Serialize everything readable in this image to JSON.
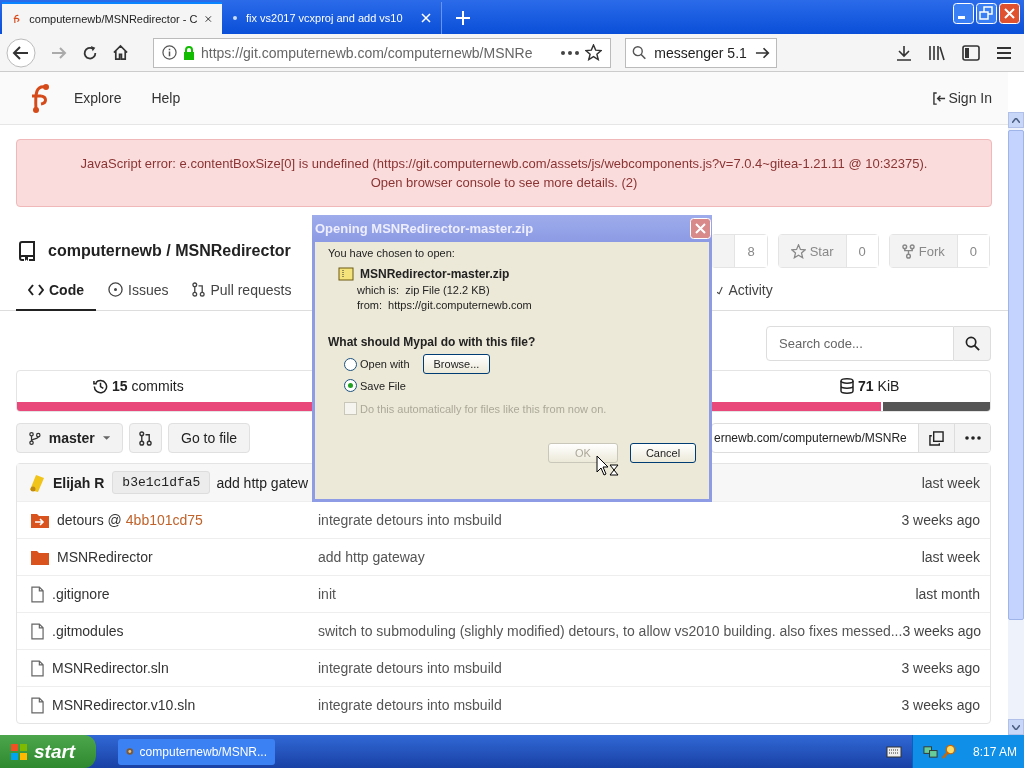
{
  "browser": {
    "tabs": [
      {
        "title": "computernewb/MSNRedirector - C",
        "selected": true
      },
      {
        "title": "fix vs2017 vcxproj and add vs10",
        "selected": false
      }
    ],
    "url": "https://git.computernewb.com/computernewb/MSNRe",
    "search": "messenger 5.1"
  },
  "site_nav": {
    "items": [
      "Explore",
      "Help"
    ],
    "sign_in": "Sign In"
  },
  "error": {
    "lines": [
      "JavaScript error: e.contentBoxSize[0] is undefined (https://git.computernewb.com/assets/js/webcomponents.js?v=7.0.4~gitea-1.21.11 @ 10:32375).",
      "Open browser console to see more details. (2)"
    ]
  },
  "repo": {
    "path": "computernewb / MSNRedirector",
    "watch_count": "8",
    "star": {
      "label": "Star",
      "count": "0"
    },
    "fork": {
      "label": "Fork",
      "count": "0"
    }
  },
  "repo_tabs": [
    {
      "kind": "code",
      "label": "Code",
      "selected": true
    },
    {
      "kind": "issues",
      "label": "Issues",
      "selected": false
    },
    {
      "kind": "pulls",
      "label": "Pull requests",
      "selected": false
    },
    {
      "kind": "activity",
      "label": "Activity",
      "selected": false
    }
  ],
  "search_code": {
    "placeholder": "Search code..."
  },
  "stats": {
    "commits_count": "15",
    "commits_label": "commits",
    "size_count": "71",
    "size_unit": "KiB"
  },
  "language_bar": [
    {
      "color": "#e9487a",
      "level": 0.89
    },
    {
      "color": "#555555",
      "level": 0.11
    }
  ],
  "branch": {
    "name": "master",
    "go_to_file": "Go to file",
    "clone_url": "ernewb.com/computernewb/MSNRe"
  },
  "latest_commit": {
    "author": "Elijah R",
    "sha": "b3e1c1dfa5",
    "message": "add http gatew",
    "time": "last week"
  },
  "files": [
    {
      "kind": "submodule",
      "name": "detours @",
      "ref": "4bb101cd75",
      "message": "integrate detours into msbuild",
      "time": "3 weeks ago"
    },
    {
      "kind": "folder",
      "name": "MSNRedirector",
      "message": "add http gateway",
      "time": "last week"
    },
    {
      "kind": "file",
      "name": ".gitignore",
      "message": "init",
      "time": "last month"
    },
    {
      "kind": "file",
      "name": ".gitmodules",
      "message": "switch to submoduling (slighly modified) detours, to allow vs2010 building. also fixes messed...",
      "time": "3 weeks ago"
    },
    {
      "kind": "file",
      "name": "MSNRedirector.sln",
      "message": "integrate detours into msbuild",
      "time": "3 weeks ago"
    },
    {
      "kind": "file",
      "name": "MSNRedirector.v10.sln",
      "message": "integrate detours into msbuild",
      "time": "3 weeks ago"
    }
  ],
  "dialog": {
    "title": "Opening MSNRedirector-master.zip",
    "intro": "You have chosen to open:",
    "file_name": "MSNRedirector-master.zip",
    "type_label": "which is:",
    "type": "zip File (12.2 KB)",
    "from_label": "from:",
    "from": "https://git.computernewb.com",
    "question": "What should Mypal do with this file?",
    "options": [
      {
        "label": "Open with",
        "selected": false
      },
      {
        "label": "Save File",
        "selected": true
      }
    ],
    "browse": "Browse...",
    "auto": {
      "label": "Do this automatically for files like this from now on.",
      "checked": false,
      "disabled": true
    },
    "ok": {
      "label": "OK",
      "disabled": true
    },
    "cancel": "Cancel"
  },
  "taskbar": {
    "start": "start",
    "tasks": [
      {
        "label": "computernewb/MSNR...",
        "selected": false
      }
    ],
    "clock": "8:17 AM"
  }
}
